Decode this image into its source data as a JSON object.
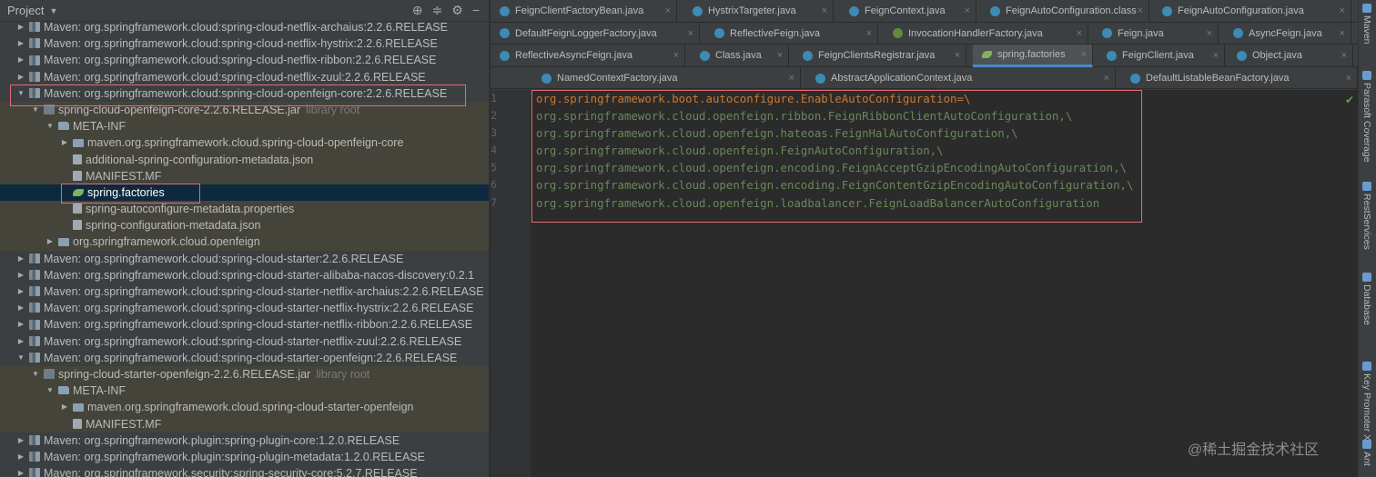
{
  "project": {
    "title": "Project",
    "icons": [
      "target-icon",
      "collapse-icon",
      "gear-icon",
      "hide-icon"
    ],
    "rows": [
      {
        "level": 0,
        "toggle": "▶",
        "icon": "lib",
        "text": "Maven: org.springframework.cloud:spring-cloud-netflix-archaius:2.2.6.RELEASE"
      },
      {
        "level": 0,
        "toggle": "▶",
        "icon": "lib",
        "text": "Maven: org.springframework.cloud:spring-cloud-netflix-hystrix:2.2.6.RELEASE"
      },
      {
        "level": 0,
        "toggle": "▶",
        "icon": "lib",
        "text": "Maven: org.springframework.cloud:spring-cloud-netflix-ribbon:2.2.6.RELEASE"
      },
      {
        "level": 0,
        "toggle": "▶",
        "icon": "lib",
        "text": "Maven: org.springframework.cloud:spring-cloud-netflix-zuul:2.2.6.RELEASE"
      },
      {
        "level": 0,
        "toggle": "▼",
        "icon": "lib",
        "text": "Maven: org.springframework.cloud:spring-cloud-openfeign-core:2.2.6.RELEASE"
      },
      {
        "level": 1,
        "toggle": "▼",
        "icon": "jar",
        "text": "spring-cloud-openfeign-core-2.2.6.RELEASE.jar",
        "dim": "library root",
        "alt": true
      },
      {
        "level": 2,
        "toggle": "▼",
        "icon": "fld",
        "text": "META-INF",
        "alt": true
      },
      {
        "level": 3,
        "toggle": "▶",
        "icon": "pk",
        "text": "maven.org.springframework.cloud.spring-cloud-openfeign-core",
        "alt": true
      },
      {
        "level": 3,
        "toggle": "",
        "icon": "js",
        "text": "additional-spring-configuration-metadata.json",
        "alt": true
      },
      {
        "level": 3,
        "toggle": "",
        "icon": "mf",
        "text": "MANIFEST.MF",
        "alt": true
      },
      {
        "level": 3,
        "toggle": "",
        "icon": "sp",
        "text": "spring.factories",
        "sel": true
      },
      {
        "level": 3,
        "toggle": "",
        "icon": "js",
        "text": "spring-autoconfigure-metadata.properties",
        "alt": true
      },
      {
        "level": 3,
        "toggle": "",
        "icon": "js",
        "text": "spring-configuration-metadata.json",
        "alt": true
      },
      {
        "level": 2,
        "toggle": "▶",
        "icon": "pk",
        "text": "org.springframework.cloud.openfeign",
        "alt": true
      },
      {
        "level": 0,
        "toggle": "▶",
        "icon": "lib",
        "text": "Maven: org.springframework.cloud:spring-cloud-starter:2.2.6.RELEASE"
      },
      {
        "level": 0,
        "toggle": "▶",
        "icon": "lib",
        "text": "Maven: org.springframework.cloud:spring-cloud-starter-alibaba-nacos-discovery:0.2.1"
      },
      {
        "level": 0,
        "toggle": "▶",
        "icon": "lib",
        "text": "Maven: org.springframework.cloud:spring-cloud-starter-netflix-archaius:2.2.6.RELEASE"
      },
      {
        "level": 0,
        "toggle": "▶",
        "icon": "lib",
        "text": "Maven: org.springframework.cloud:spring-cloud-starter-netflix-hystrix:2.2.6.RELEASE"
      },
      {
        "level": 0,
        "toggle": "▶",
        "icon": "lib",
        "text": "Maven: org.springframework.cloud:spring-cloud-starter-netflix-ribbon:2.2.6.RELEASE"
      },
      {
        "level": 0,
        "toggle": "▶",
        "icon": "lib",
        "text": "Maven: org.springframework.cloud:spring-cloud-starter-netflix-zuul:2.2.6.RELEASE"
      },
      {
        "level": 0,
        "toggle": "▼",
        "icon": "lib",
        "text": "Maven: org.springframework.cloud:spring-cloud-starter-openfeign:2.2.6.RELEASE"
      },
      {
        "level": 1,
        "toggle": "▼",
        "icon": "jar",
        "text": "spring-cloud-starter-openfeign-2.2.6.RELEASE.jar",
        "dim": "library root",
        "alt": true
      },
      {
        "level": 2,
        "toggle": "▼",
        "icon": "fld",
        "text": "META-INF",
        "alt": true
      },
      {
        "level": 3,
        "toggle": "▶",
        "icon": "pk",
        "text": "maven.org.springframework.cloud.spring-cloud-starter-openfeign",
        "alt": true
      },
      {
        "level": 3,
        "toggle": "",
        "icon": "mf",
        "text": "MANIFEST.MF",
        "alt": true
      },
      {
        "level": 0,
        "toggle": "▶",
        "icon": "lib",
        "text": "Maven: org.springframework.plugin:spring-plugin-core:1.2.0.RELEASE"
      },
      {
        "level": 0,
        "toggle": "▶",
        "icon": "lib",
        "text": "Maven: org.springframework.plugin:spring-plugin-metadata:1.2.0.RELEASE"
      },
      {
        "level": 0,
        "toggle": "▶",
        "icon": "lib",
        "text": "Maven: org.springframework.security:spring-security-core:5.2.7.RELEASE"
      }
    ]
  },
  "tab_rows": [
    [
      {
        "label": "FeignClientFactoryBean.java",
        "icon": "c",
        "close": "×"
      },
      {
        "label": "HystrixTargeter.java",
        "icon": "c",
        "close": "×"
      },
      {
        "label": "FeignContext.java",
        "icon": "c",
        "close": "×"
      },
      {
        "label": "FeignAutoConfiguration.class",
        "icon": "c",
        "close": "×"
      },
      {
        "label": "FeignAutoConfiguration.java",
        "icon": "c",
        "close": "×"
      }
    ],
    [
      {
        "label": "DefaultFeignLoggerFactory.java",
        "icon": "c",
        "close": "×"
      },
      {
        "label": "ReflectiveFeign.java",
        "icon": "c",
        "close": "×"
      },
      {
        "label": "InvocationHandlerFactory.java",
        "icon": "i",
        "close": "×"
      },
      {
        "label": "Feign.java",
        "icon": "c",
        "close": "×"
      },
      {
        "label": "AsyncFeign.java",
        "icon": "c",
        "close": "×"
      }
    ],
    [
      {
        "label": "ReflectiveAsyncFeign.java",
        "icon": "c",
        "close": "×"
      },
      {
        "label": "Class.java",
        "icon": "c",
        "close": "×"
      },
      {
        "label": "FeignClientsRegistrar.java",
        "icon": "c",
        "close": "×"
      },
      {
        "label": "spring.factories",
        "icon": "sp",
        "close": "×",
        "active": true
      },
      {
        "label": "FeignClient.java",
        "icon": "c",
        "close": "×"
      },
      {
        "label": "Object.java",
        "icon": "c",
        "close": "×"
      }
    ],
    [
      {
        "label": "NamedContextFactory.java",
        "icon": "c",
        "close": "×"
      },
      {
        "label": "AbstractApplicationContext.java",
        "icon": "c",
        "close": "×"
      },
      {
        "label": "DefaultListableBeanFactory.java",
        "icon": "c",
        "close": "×"
      }
    ]
  ],
  "editor": {
    "line_numbers": [
      "1",
      "2",
      "3",
      "4",
      "5",
      "6",
      "7"
    ],
    "lines": [
      "org.springframework.boot.autoconfigure.EnableAutoConfiguration=\\",
      "org.springframework.cloud.openfeign.ribbon.FeignRibbonClientAutoConfiguration,\\",
      "org.springframework.cloud.openfeign.hateoas.FeignHalAutoConfiguration,\\",
      "org.springframework.cloud.openfeign.FeignAutoConfiguration,\\",
      "org.springframework.cloud.openfeign.encoding.FeignAcceptGzipEncodingAutoConfiguration,\\",
      "org.springframework.cloud.openfeign.encoding.FeignContentGzipEncodingAutoConfiguration,\\",
      "org.springframework.cloud.openfeign.loadbalancer.FeignLoadBalancerAutoConfiguration"
    ],
    "status_icon": "check-icon"
  },
  "right_tools": [
    {
      "label": "Maven",
      "icon": "maven-icon"
    },
    {
      "label": "Parasoft Coverage",
      "icon": "coverage-icon"
    },
    {
      "label": "RestServices",
      "icon": "rest-icon"
    },
    {
      "label": "Database",
      "icon": "database-icon"
    },
    {
      "label": "Key Promoter X",
      "icon": "key-icon"
    },
    {
      "label": "Ant",
      "icon": "ant-icon"
    }
  ],
  "watermark": "@稀土掘金技术社区",
  "colors": {
    "highlight": "#e06c75",
    "selection": "#0d293e",
    "code_string": "#6a8759",
    "keyword": "#cc7832"
  }
}
